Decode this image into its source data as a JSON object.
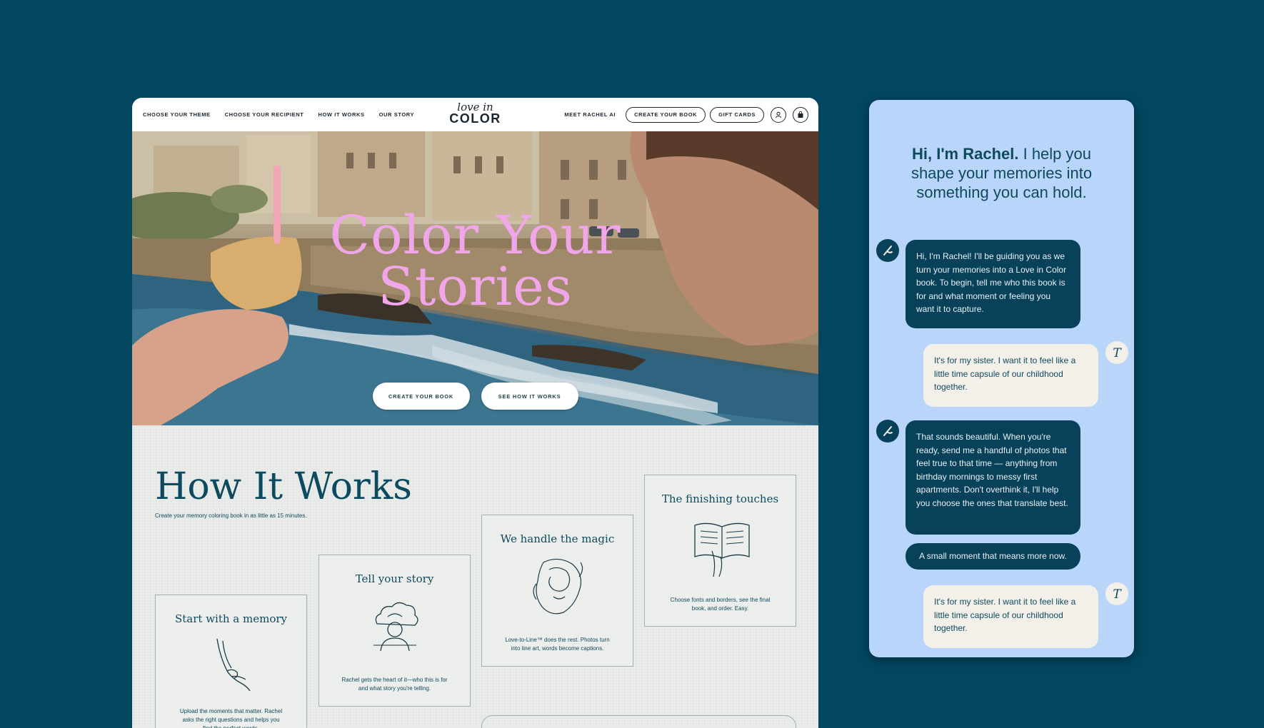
{
  "nav": {
    "left": [
      "CHOOSE YOUR THEME",
      "CHOOSE YOUR RECIPIENT",
      "HOW IT WORKS",
      "OUR STORY"
    ],
    "logo_script": "love in",
    "logo_main": "COLOR",
    "meet": "MEET RACHEL AI",
    "create": "CREATE YOUR BOOK",
    "gift": "GIFT CARDS",
    "account_icon": "person-icon",
    "cart_icon": "bag-icon"
  },
  "hero": {
    "title_line1": "Color Your",
    "title_line2": "Stories",
    "cta_primary": "CREATE YOUR BOOK",
    "cta_secondary": "SEE HOW IT WORKS"
  },
  "how": {
    "title": "How It Works",
    "subtitle": "Create your memory coloring book in as little as 15 minutes.",
    "steps": [
      {
        "title": "Start with a memory",
        "text": "Upload the moments that matter. Rachel asks the right questions and helps you find the perfect words."
      },
      {
        "title": "Tell your story",
        "text": "Rachel gets the heart of it—who this is for and what story you're telling."
      },
      {
        "title": "We handle the magic",
        "text": "Love-to-Line™ does the rest. Photos turn into line art, words become captions."
      },
      {
        "title": "The finishing touches",
        "text": "Choose fonts and borders, see the final book, and order. Easy."
      }
    ]
  },
  "chat": {
    "heading_bold": "Hi, I'm Rachel.",
    "heading_rest": " I help you shape your memories into something you can hold.",
    "messages": [
      {
        "from": "ai",
        "text": "Hi, I'm Rachel! I'll be guiding you as we turn your memories into a Love in Color book. To begin, tell me who this book is for and what moment or feeling you want it to capture."
      },
      {
        "from": "user",
        "text": "It's for my sister. I want it to feel like a little time capsule of our childhood together."
      },
      {
        "from": "ai",
        "text": "That sounds beautiful. When you're ready, send me a handful of photos that feel true to that time — anything from birthday mornings to messy first apartments. Don't overthink it, I'll help you choose the ones that translate best."
      },
      {
        "from": "ai",
        "text": "A small moment that means more now."
      },
      {
        "from": "user",
        "text": "It's for my sister. I want it to feel like a little time capsule of our childhood together."
      }
    ],
    "ai_avatar_icon": "pen-icon",
    "user_avatar_initial": "T"
  },
  "colors": {
    "background": "#02465f",
    "hero_title": "#f2a6ea",
    "chat_panel": "#b9d5fa",
    "ai_bubble": "#08415a",
    "user_bubble": "#f3f0ea"
  }
}
